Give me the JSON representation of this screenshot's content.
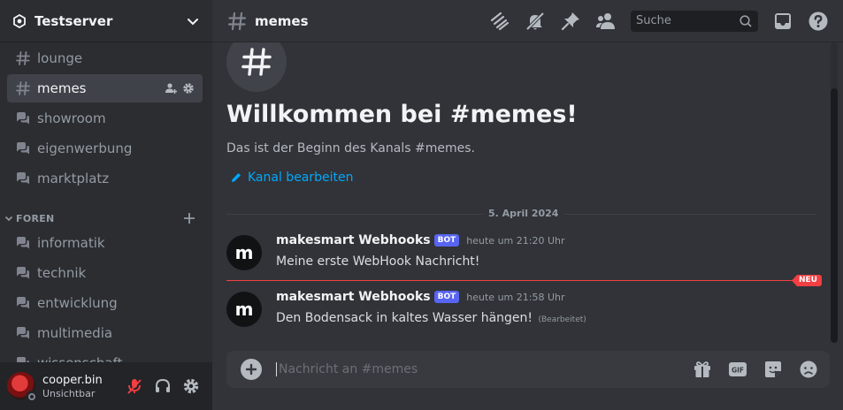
{
  "server": {
    "name": "Testserver"
  },
  "channels": [
    {
      "name": "lounge",
      "icon": "hash-icon"
    },
    {
      "name": "memes",
      "icon": "hash-icon",
      "active": true
    },
    {
      "name": "showroom",
      "icon": "forum-icon"
    },
    {
      "name": "eigenwerbung",
      "icon": "forum-icon"
    },
    {
      "name": "marktplatz",
      "icon": "forum-icon"
    }
  ],
  "category": {
    "name": "FOREN",
    "channels": [
      {
        "name": "informatik",
        "icon": "forum-icon"
      },
      {
        "name": "technik",
        "icon": "forum-icon"
      },
      {
        "name": "entwicklung",
        "icon": "forum-icon"
      },
      {
        "name": "multimedia",
        "icon": "forum-icon"
      },
      {
        "name": "wissenschaft",
        "icon": "forum-icon"
      }
    ]
  },
  "user": {
    "name": "cooper.bin",
    "status": "Unsichtbar"
  },
  "topbar": {
    "channel": "memes",
    "search_placeholder": "Suche"
  },
  "welcome": {
    "title": "Willkommen bei #memes!",
    "subtitle": "Das ist der Beginn des Kanals #memes.",
    "edit_label": "Kanal bearbeiten"
  },
  "date_divider": "5. April 2024",
  "new_badge": "NEU",
  "messages": [
    {
      "avatar_letter": "m",
      "author": "makesmart Webhooks",
      "tag": "BOT",
      "time": "heute um 21:20 Uhr",
      "text": "Meine erste WebHook Nachricht!",
      "edited": ""
    },
    {
      "avatar_letter": "m",
      "author": "makesmart Webhooks",
      "tag": "BOT",
      "time": "heute um 21:58 Uhr",
      "text": "Den Bodensack in kaltes Wasser hängen!",
      "edited": "(Bearbeitet)"
    }
  ],
  "composer": {
    "placeholder": "Nachricht an #memes"
  },
  "colors": {
    "accent": "#5865f2",
    "link": "#00a8fc",
    "new": "#f23f43",
    "muted_mic": "#f23f43"
  }
}
